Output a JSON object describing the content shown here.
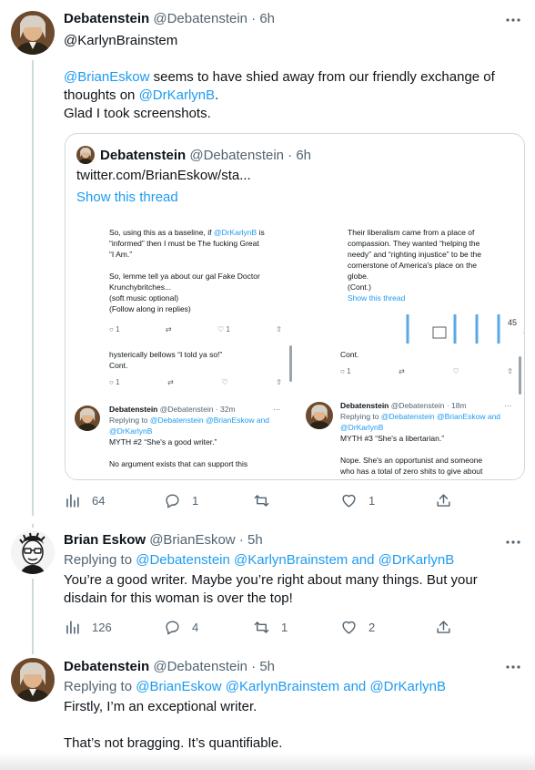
{
  "tweet1": {
    "name": "Debatenstein",
    "handle": "@Debatenstein",
    "sep": "·",
    "time": "6h",
    "mention_top": "@KarlynBrainstem",
    "body_mention1": "@BrianEskow",
    "body_part1": " seems to have shied away from our friendly exchange of thoughts on ",
    "body_mention2": "@DrKarlynB",
    "body_part2": ".",
    "body_line3": "Glad I took screenshots.",
    "quote": {
      "name": "Debatenstein",
      "handle": "@Debatenstein",
      "sep": "·",
      "time": "6h",
      "link": "twitter.com/BrianEskow/sta...",
      "show_thread": "Show this thread",
      "shot_left_top": {
        "l1a": "So, using this as a baseline, if ",
        "l1b": "@DrKarlynB",
        "l1c": " is",
        "l2": "“informed” then I must be The fucking Great",
        "l3": "“I Am.”",
        "l4": "So, lemme tell ya about our gal Fake Doctor",
        "l5": "Krunchybritches...",
        "l6": "(soft music optional)",
        "l7": "(Follow along in replies)",
        "reply_count": "1",
        "like_count": "1"
      },
      "shot_left_mid": {
        "l1": "hysterically bellows “I told ya so!”",
        "l2": "Cont.",
        "reply_count": "1"
      },
      "shot_left_bottom": {
        "name": "Debatenstein",
        "meta": "@Debatenstein · 32m",
        "more": "···",
        "replying": "Replying to ",
        "mentions": "@Debatenstein @BrianEskow and",
        "mentions2": "@DrKarlynB",
        "l1": "MYTH #2 “She's a good writer.”",
        "l2": "No argument exists that can support this"
      },
      "shot_right_top": {
        "l1": "Their liberalism came from a place of",
        "l2": "compassion. They wanted “helping the",
        "l3": "needy” and “righting injustice” to be the",
        "l4": "cornerstone of America's place on the",
        "l5": "globe.",
        "l6": "(Cont.)",
        "show_thread": "Show this thread",
        "comic_num": "45"
      },
      "shot_right_mid": {
        "l1": "Cont.",
        "reply_count": "1"
      },
      "shot_right_bottom": {
        "name": "Debatenstein",
        "meta": "@Debatenstein · 18m",
        "more": "···",
        "replying": "Replying to ",
        "mentions": "@Debatenstein @BrianEskow and",
        "mentions2": "@DrKarlynB",
        "l1": "MYTH #3 “She's a libertarian.”",
        "l2": "Nope. She's an opportunist and someone",
        "l3": "who has a total of zero shits to give about"
      }
    },
    "stats": {
      "views": "64",
      "replies": "1",
      "retweets": "",
      "likes": "1"
    }
  },
  "tweet2": {
    "name": "Brian Eskow",
    "handle": "@BrianEskow",
    "sep": "·",
    "time": "5h",
    "replying": "Replying to ",
    "mentions": "@Debatenstein @KarlynBrainstem and @DrKarlynB",
    "body": "You’re a good writer. Maybe you’re right about many things. But your disdain for this woman is over the top!",
    "stats": {
      "views": "126",
      "replies": "4",
      "retweets": "1",
      "likes": "2"
    }
  },
  "tweet3": {
    "name": "Debatenstein",
    "handle": "@Debatenstein",
    "sep": "·",
    "time": "5h",
    "replying": "Replying to ",
    "mentions": "@BrianEskow @KarlynBrainstem and @DrKarlynB",
    "body1": "Firstly, I’m an exceptional writer.",
    "body2": "That’s not bragging. It’s quantifiable."
  },
  "icons": [
    "more-icon",
    "views-icon",
    "reply-icon",
    "retweet-icon",
    "like-icon",
    "share-icon"
  ],
  "colors": {
    "accent": "#1d9bf0",
    "secondary": "#536471",
    "border": "#cfd9de"
  }
}
